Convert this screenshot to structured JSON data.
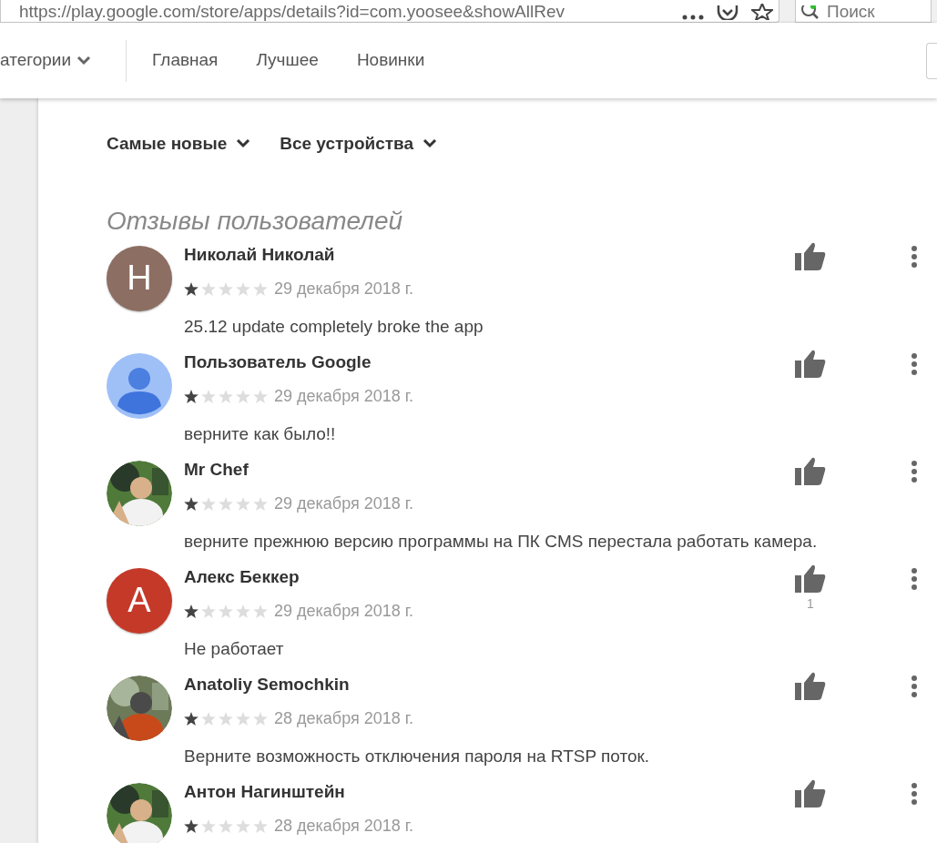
{
  "browser": {
    "url": "https://play.google.com/store/apps/details?id=com.yoosee&showAllRev",
    "search_placeholder": "Поиск"
  },
  "nav": {
    "categories": "атегории",
    "links": [
      "Главная",
      "Лучшее",
      "Новинки"
    ]
  },
  "filters": [
    "Самые новые",
    "Все устройства"
  ],
  "section_title": "Отзывы пользователей",
  "reviews": [
    {
      "avatar": {
        "kind": "letter",
        "letter": "Н",
        "color": "#8d6e63"
      },
      "author": "Николай Николай",
      "stars": 1,
      "date": "29 декабря 2018 г.",
      "text": "25.12 update completely broke the app"
    },
    {
      "avatar": {
        "kind": "silhouette"
      },
      "author": "Пользователь Google",
      "stars": 1,
      "date": "29 декабря 2018 г.",
      "text": "верните как было!!"
    },
    {
      "author": "Mr Chef",
      "stars": 1,
      "date": "29 декабря 2018 г.",
      "text": "верните прежнюю версию программы на ПК CMS перестала работать камера."
    },
    {
      "avatar": {
        "kind": "letter",
        "letter": "А",
        "color": "#c53929"
      },
      "author": "Алекс Беккер",
      "stars": 1,
      "date": "29 декабря 2018 г.",
      "text": "Не работает",
      "likes": "1"
    },
    {
      "author": "Anatoliy Semochkin",
      "stars": 1,
      "date": "28 декабря 2018 г.",
      "text": "Верните возможность отключения пароля на RTSP поток."
    },
    {
      "author": "Антон Нагинштейн",
      "stars": 1,
      "date": "28 декабря 2018 г."
    }
  ]
}
